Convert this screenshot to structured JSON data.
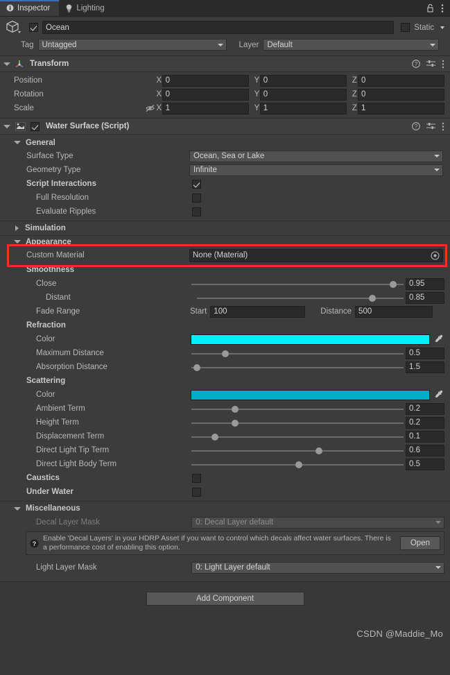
{
  "window": {
    "tabs": [
      {
        "label": "Inspector",
        "icon": "info-icon",
        "active": true
      },
      {
        "label": "Lighting",
        "icon": "lightbulb-icon",
        "active": false
      }
    ],
    "lock_icon": "lock-icon",
    "menu_icon": "kebab-menu-icon"
  },
  "gameobject": {
    "icon": "cube-icon",
    "enabled": true,
    "name": "Ocean",
    "static_label": "Static",
    "static_checked": false,
    "tag_label": "Tag",
    "tag_value": "Untagged",
    "layer_label": "Layer",
    "layer_value": "Default"
  },
  "transform": {
    "title": "Transform",
    "icon": "transform-axis-icon",
    "rows": [
      {
        "label": "Position",
        "x": "0",
        "y": "0",
        "z": "0",
        "has_link_icon": false
      },
      {
        "label": "Rotation",
        "x": "0",
        "y": "0",
        "z": "0",
        "has_link_icon": false
      },
      {
        "label": "Scale",
        "x": "1",
        "y": "1",
        "z": "1",
        "has_link_icon": true
      }
    ],
    "axis_labels": {
      "x": "X",
      "y": "Y",
      "z": "Z"
    }
  },
  "water_surface": {
    "title": "Water Surface (Script)",
    "icon": "script-icon",
    "enabled": true,
    "general": {
      "header": "General",
      "surface_type_label": "Surface Type",
      "surface_type_value": "Ocean, Sea or Lake",
      "geometry_type_label": "Geometry Type",
      "geometry_type_value": "Infinite",
      "script_interactions_label": "Script Interactions",
      "script_interactions_checked": true,
      "full_resolution_label": "Full Resolution",
      "full_resolution_checked": false,
      "evaluate_ripples_label": "Evaluate Ripples",
      "evaluate_ripples_checked": false
    },
    "simulation": {
      "header": "Simulation",
      "expanded": false
    },
    "appearance": {
      "header": "Appearance",
      "custom_material_label": "Custom Material",
      "custom_material_value": "None (Material)",
      "smoothness_header": "Smoothness",
      "close_label": "Close",
      "close_value": "0.95",
      "close_fraction": 0.95,
      "distant_label": "Distant",
      "distant_value": "0.85",
      "distant_fraction": 0.85,
      "fade_range_label": "Fade Range",
      "fade_start_label": "Start",
      "fade_start_value": "100",
      "fade_distance_label": "Distance",
      "fade_distance_value": "500",
      "refraction_header": "Refraction",
      "refraction_color_label": "Color",
      "refraction_color": "#00f0ff",
      "max_distance_label": "Maximum Distance",
      "max_distance_value": "0.5",
      "max_distance_fraction": 0.16,
      "absorption_distance_label": "Absorption Distance",
      "absorption_distance_value": "1.5",
      "absorption_distance_fraction": 0.025,
      "scattering_header": "Scattering",
      "scattering_color_label": "Color",
      "scattering_color": "#00acc8",
      "ambient_term_label": "Ambient Term",
      "ambient_term_value": "0.2",
      "ambient_term_fraction": 0.207,
      "height_term_label": "Height Term",
      "height_term_value": "0.2",
      "height_term_fraction": 0.207,
      "displacement_term_label": "Displacement Term",
      "displacement_term_value": "0.1",
      "displacement_term_fraction": 0.11,
      "direct_light_tip_label": "Direct Light Tip Term",
      "direct_light_tip_value": "0.6",
      "direct_light_tip_fraction": 0.6,
      "direct_light_body_label": "Direct Light Body Term",
      "direct_light_body_value": "0.5",
      "direct_light_body_fraction": 0.505,
      "caustics_label": "Caustics",
      "caustics_checked": false,
      "under_water_label": "Under Water",
      "under_water_checked": false
    },
    "miscellaneous": {
      "header": "Miscellaneous",
      "decal_layer_mask_label": "Decal Layer Mask",
      "decal_layer_mask_value": "0: Decal Layer default",
      "help_text": "Enable 'Decal Layers' in your HDRP Asset if you want to control which decals affect water surfaces. There is a performance cost of enabling this option.",
      "help_icon": "help-question-icon",
      "open_button_label": "Open",
      "light_layer_mask_label": "Light Layer Mask",
      "light_layer_mask_value": "0: Light Layer default"
    }
  },
  "footer": {
    "add_component_label": "Add Component",
    "watermark": "CSDN @Maddie_Mo"
  },
  "highlight": {
    "color": "#f33022",
    "target": "custom-material-row"
  }
}
